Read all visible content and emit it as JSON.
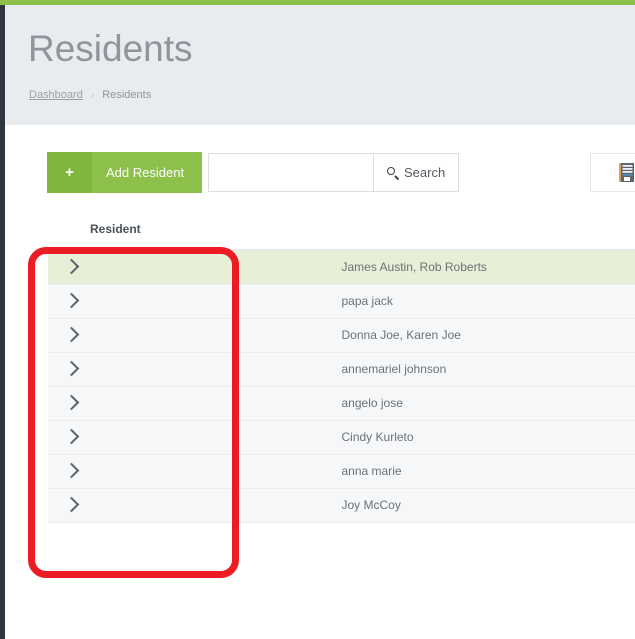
{
  "theme": {
    "accent_green": "#8cc04b",
    "header_bg": "#e8ecef",
    "rail_dark": "#2f3640",
    "row_bg": "#f6f7f8",
    "row_highlight": "#e7efd6",
    "annotation_red": "#ed1c24"
  },
  "header": {
    "title": "Residents",
    "breadcrumb": {
      "link_label": "Dashboard",
      "separator": "›",
      "current_label": "Residents"
    }
  },
  "toolbar": {
    "add_button": {
      "icon": "plus-icon",
      "plus_glyph": "+",
      "label": "Add Resident"
    },
    "search": {
      "value": "",
      "placeholder": "",
      "button_label": "Search",
      "button_icon": "search-icon"
    },
    "building_button": {
      "icon": "building-icon",
      "label": ""
    }
  },
  "table": {
    "columns": [
      "Resident"
    ],
    "rows": [
      {
        "chevron": "chevron-right-icon",
        "name": "James Austin, Rob Roberts",
        "highlighted": true
      },
      {
        "chevron": "chevron-right-icon",
        "name": "papa jack",
        "highlighted": false
      },
      {
        "chevron": "chevron-right-icon",
        "name": "Donna Joe, Karen Joe",
        "highlighted": false
      },
      {
        "chevron": "chevron-right-icon",
        "name": "annemariel johnson",
        "highlighted": false
      },
      {
        "chevron": "chevron-right-icon",
        "name": "angelo jose",
        "highlighted": false
      },
      {
        "chevron": "chevron-right-icon",
        "name": "Cindy Kurleto",
        "highlighted": false
      },
      {
        "chevron": "chevron-right-icon",
        "name": "anna marie",
        "highlighted": false
      },
      {
        "chevron": "chevron-right-icon",
        "name": "Joy McCoy",
        "highlighted": false
      }
    ]
  },
  "annotation": {
    "shape": "rounded-rectangle",
    "color": "#ed1c24",
    "target": "resident-name-column"
  }
}
